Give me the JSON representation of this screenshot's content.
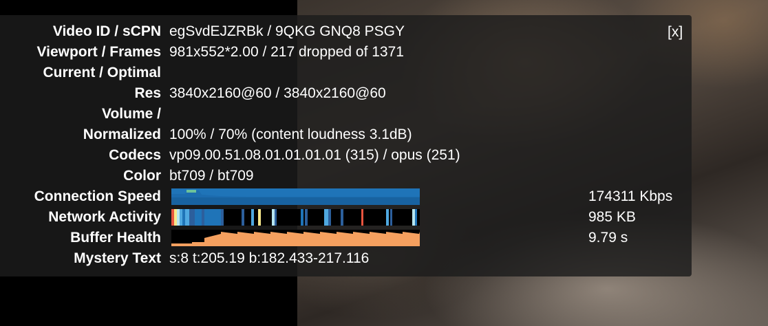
{
  "close_label": "[x]",
  "rows": {
    "video_id": {
      "label": "Video ID / sCPN",
      "value": "egSvdEJZRBk / 9QKG GNQ8 PSGY"
    },
    "viewport": {
      "label": "Viewport / Frames",
      "value": "981x552*2.00 / 217 dropped of 1371"
    },
    "current_optimal": {
      "label": "Current / Optimal"
    },
    "res": {
      "label": "Res",
      "value": "3840x2160@60 / 3840x2160@60"
    },
    "volume": {
      "label": "Volume /"
    },
    "normalized": {
      "label": "Normalized",
      "value": "100% / 70% (content loudness 3.1dB)"
    },
    "codecs": {
      "label": "Codecs",
      "value": "vp09.00.51.08.01.01.01.01 (315) / opus (251)"
    },
    "color": {
      "label": "Color",
      "value": "bt709 / bt709"
    },
    "connection": {
      "label": "Connection Speed",
      "readout": "174311 Kbps"
    },
    "network": {
      "label": "Network Activity",
      "readout": "985 KB"
    },
    "buffer": {
      "label": "Buffer Health",
      "readout": "9.79 s"
    },
    "mystery": {
      "label": "Mystery Text",
      "value": "s:8 t:205.19 b:182.433-217.116"
    }
  },
  "colors": {
    "connection_main": "#1f74b8",
    "connection_dark": "#155a94",
    "connection_green": "#6dc39a",
    "buffer_fill": "#f5a05f",
    "network_palette": [
      "#1f74b8",
      "#4fa8e0",
      "#b8e6f0",
      "#f7e78a",
      "#e8543f",
      "#2c5f9c"
    ]
  }
}
